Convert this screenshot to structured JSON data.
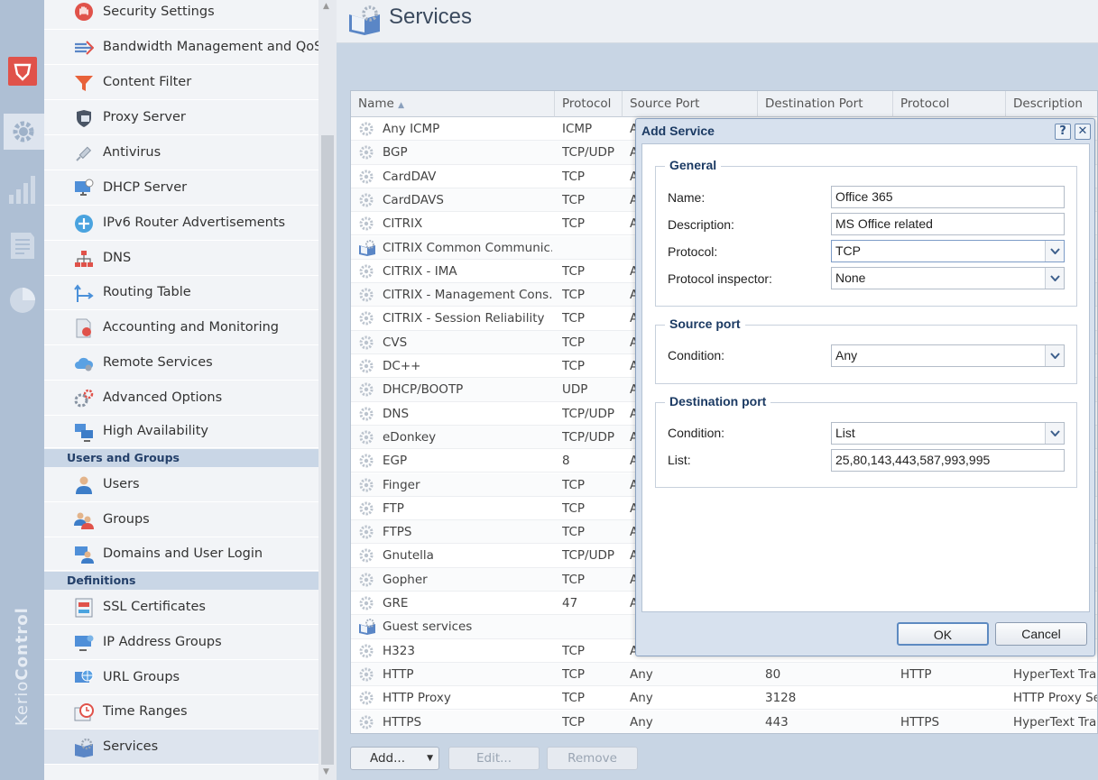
{
  "brand": {
    "prefix": "Kerio",
    "name": "Control"
  },
  "rail": {
    "icons": [
      "shield-icon",
      "gear-icon",
      "bar-chart-icon",
      "document-icon",
      "pie-chart-icon"
    ]
  },
  "nav": {
    "items_top": [
      {
        "label": "Security Settings",
        "icon": "hand-stop-icon"
      },
      {
        "label": "Bandwidth Management and QoS",
        "icon": "bandwidth-icon"
      },
      {
        "label": "Content Filter",
        "icon": "funnel-icon"
      },
      {
        "label": "Proxy Server",
        "icon": "proxy-shield-icon"
      },
      {
        "label": "Antivirus",
        "icon": "syringe-icon"
      },
      {
        "label": "DHCP Server",
        "icon": "monitor-icon"
      },
      {
        "label": "IPv6 Router Advertisements",
        "icon": "router-icon"
      },
      {
        "label": "DNS",
        "icon": "network-tree-icon"
      },
      {
        "label": "Routing Table",
        "icon": "routing-arrows-icon"
      },
      {
        "label": "Accounting and Monitoring",
        "icon": "accounting-icon"
      },
      {
        "label": "Remote Services",
        "icon": "cloud-icon"
      },
      {
        "label": "Advanced Options",
        "icon": "gears-icon"
      },
      {
        "label": "High Availability",
        "icon": "computers-icon"
      }
    ],
    "section_users": "Users and Groups",
    "items_users": [
      {
        "label": "Users",
        "icon": "user-icon"
      },
      {
        "label": "Groups",
        "icon": "users-group-icon"
      },
      {
        "label": "Domains and User Login",
        "icon": "domain-user-icon"
      }
    ],
    "section_defs": "Definitions",
    "items_defs": [
      {
        "label": "SSL Certificates",
        "icon": "certificate-icon"
      },
      {
        "label": "IP Address Groups",
        "icon": "ip-group-icon"
      },
      {
        "label": "URL Groups",
        "icon": "globe-icon"
      },
      {
        "label": "Time Ranges",
        "icon": "clock-icon"
      },
      {
        "label": "Services",
        "icon": "services-book-icon"
      }
    ],
    "selected": "Services"
  },
  "page": {
    "title": "Services"
  },
  "grid": {
    "columns": [
      "Name",
      "Protocol",
      "Source Port",
      "Destination Port",
      "Protocol Inspector",
      "Description"
    ],
    "sort_indicator": "▲",
    "rows": [
      {
        "name": "Any ICMP",
        "protocol": "ICMP",
        "src": "A",
        "dst": "",
        "insp": "",
        "desc": "",
        "group": false
      },
      {
        "name": "BGP",
        "protocol": "TCP/UDP",
        "src": "A",
        "dst": "",
        "insp": "",
        "desc": "",
        "group": false
      },
      {
        "name": "CardDAV",
        "protocol": "TCP",
        "src": "A",
        "dst": "",
        "insp": "",
        "desc": "",
        "group": false
      },
      {
        "name": "CardDAVS",
        "protocol": "TCP",
        "src": "A",
        "dst": "",
        "insp": "",
        "desc": "",
        "group": false
      },
      {
        "name": "CITRIX",
        "protocol": "TCP",
        "src": "A",
        "dst": "",
        "insp": "",
        "desc": "",
        "group": false
      },
      {
        "name": "CITRIX Common Communic...",
        "protocol": "",
        "src": "",
        "dst": "",
        "insp": "",
        "desc": "",
        "group": true
      },
      {
        "name": "CITRIX - IMA",
        "protocol": "TCP",
        "src": "A",
        "dst": "",
        "insp": "",
        "desc": "",
        "group": false
      },
      {
        "name": "CITRIX - Management Cons...",
        "protocol": "TCP",
        "src": "A",
        "dst": "",
        "insp": "",
        "desc": "",
        "group": false
      },
      {
        "name": "CITRIX - Session Reliability",
        "protocol": "TCP",
        "src": "A",
        "dst": "",
        "insp": "",
        "desc": "",
        "group": false
      },
      {
        "name": "CVS",
        "protocol": "TCP",
        "src": "A",
        "dst": "",
        "insp": "",
        "desc": "",
        "group": false
      },
      {
        "name": "DC++",
        "protocol": "TCP",
        "src": "A",
        "dst": "",
        "insp": "",
        "desc": "",
        "group": false
      },
      {
        "name": "DHCP/BOOTP",
        "protocol": "UDP",
        "src": "A",
        "dst": "",
        "insp": "",
        "desc": "",
        "group": false
      },
      {
        "name": "DNS",
        "protocol": "TCP/UDP",
        "src": "A",
        "dst": "",
        "insp": "",
        "desc": "",
        "group": false
      },
      {
        "name": "eDonkey",
        "protocol": "TCP/UDP",
        "src": "A",
        "dst": "",
        "insp": "",
        "desc": "",
        "group": false
      },
      {
        "name": "EGP",
        "protocol": "8",
        "src": "A",
        "dst": "",
        "insp": "",
        "desc": "",
        "group": false
      },
      {
        "name": "Finger",
        "protocol": "TCP",
        "src": "A",
        "dst": "",
        "insp": "",
        "desc": "",
        "group": false
      },
      {
        "name": "FTP",
        "protocol": "TCP",
        "src": "A",
        "dst": "",
        "insp": "",
        "desc": "",
        "group": false
      },
      {
        "name": "FTPS",
        "protocol": "TCP",
        "src": "A",
        "dst": "",
        "insp": "",
        "desc": "",
        "group": false
      },
      {
        "name": "Gnutella",
        "protocol": "TCP/UDP",
        "src": "A",
        "dst": "",
        "insp": "",
        "desc": "",
        "group": false
      },
      {
        "name": "Gopher",
        "protocol": "TCP",
        "src": "A",
        "dst": "",
        "insp": "",
        "desc": "",
        "group": false
      },
      {
        "name": "GRE",
        "protocol": "47",
        "src": "A",
        "dst": "",
        "insp": "",
        "desc": "",
        "group": false
      },
      {
        "name": "Guest services",
        "protocol": "",
        "src": "",
        "dst": "",
        "insp": "",
        "desc": "",
        "group": true
      },
      {
        "name": "H323",
        "protocol": "TCP",
        "src": "A",
        "dst": "",
        "insp": "",
        "desc": "",
        "group": false
      },
      {
        "name": "HTTP",
        "protocol": "TCP",
        "src": "Any",
        "dst": "80",
        "insp": "HTTP",
        "desc": "HyperText Tran",
        "group": false
      },
      {
        "name": "HTTP Proxy",
        "protocol": "TCP",
        "src": "Any",
        "dst": "3128",
        "insp": "",
        "desc": "HTTP Proxy Ser",
        "group": false
      },
      {
        "name": "HTTPS",
        "protocol": "TCP",
        "src": "Any",
        "dst": "443",
        "insp": "HTTPS",
        "desc": "HyperText Tran",
        "group": false
      }
    ]
  },
  "actions": {
    "add": "Add...",
    "edit": "Edit...",
    "remove": "Remove"
  },
  "dialog": {
    "title": "Add Service",
    "help": "?",
    "general": {
      "legend": "General",
      "name_label": "Name:",
      "name_value": "Office 365",
      "desc_label": "Description:",
      "desc_value": "MS Office related",
      "protocol_label": "Protocol:",
      "protocol_value": "TCP",
      "inspector_label": "Protocol inspector:",
      "inspector_value": "None"
    },
    "source": {
      "legend": "Source port",
      "condition_label": "Condition:",
      "condition_value": "Any"
    },
    "destination": {
      "legend": "Destination port",
      "condition_label": "Condition:",
      "condition_value": "List",
      "list_label": "List:",
      "list_value": "25,80,143,443,587,993,995"
    },
    "ok": "OK",
    "cancel": "Cancel"
  },
  "colors": {
    "accent": "#1b3a63",
    "danger": "#e0524a",
    "nav_section": "#c9d6e6"
  }
}
